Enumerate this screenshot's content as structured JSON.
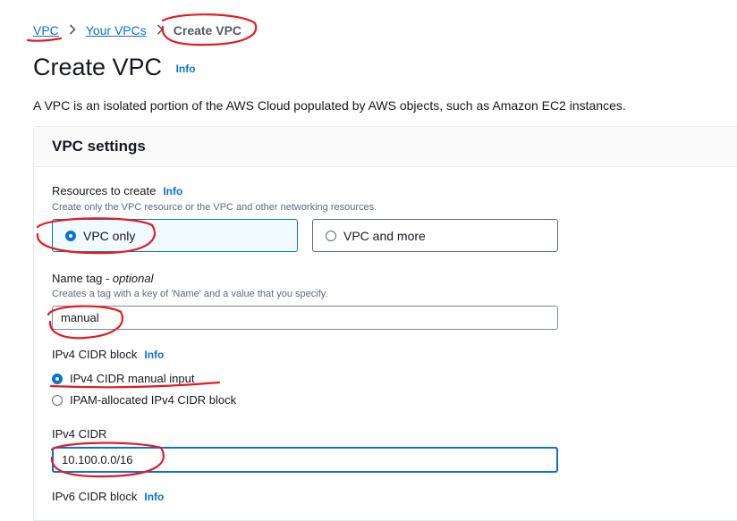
{
  "breadcrumb": {
    "items": [
      {
        "label": "VPC"
      },
      {
        "label": "Your VPCs"
      }
    ],
    "current": "Create VPC"
  },
  "page": {
    "title": "Create VPC",
    "info": "Info",
    "description": "A VPC is an isolated portion of the AWS Cloud populated by AWS objects, such as Amazon EC2 instances."
  },
  "settings": {
    "heading": "VPC settings",
    "resources": {
      "label": "Resources to create",
      "info": "Info",
      "hint": "Create only the VPC resource or the VPC and other networking resources.",
      "options": [
        {
          "label": "VPC only",
          "selected": true
        },
        {
          "label": "VPC and more",
          "selected": false
        }
      ]
    },
    "name_tag": {
      "label": "Name tag - ",
      "label_optional": "optional",
      "hint": "Creates a tag with a key of 'Name' and a value that you specify.",
      "value": "manual"
    },
    "ipv4_block": {
      "label": "IPv4 CIDR block",
      "info": "Info",
      "options": [
        {
          "label": "IPv4 CIDR manual input",
          "selected": true
        },
        {
          "label": "IPAM-allocated IPv4 CIDR block",
          "selected": false
        }
      ]
    },
    "ipv4_cidr": {
      "label": "IPv4 CIDR",
      "value": "10.100.0.0/16"
    },
    "ipv6_block": {
      "label": "IPv6 CIDR block",
      "info": "Info"
    }
  },
  "colors": {
    "link": "#0972d3",
    "annotation": "#e31b23"
  }
}
